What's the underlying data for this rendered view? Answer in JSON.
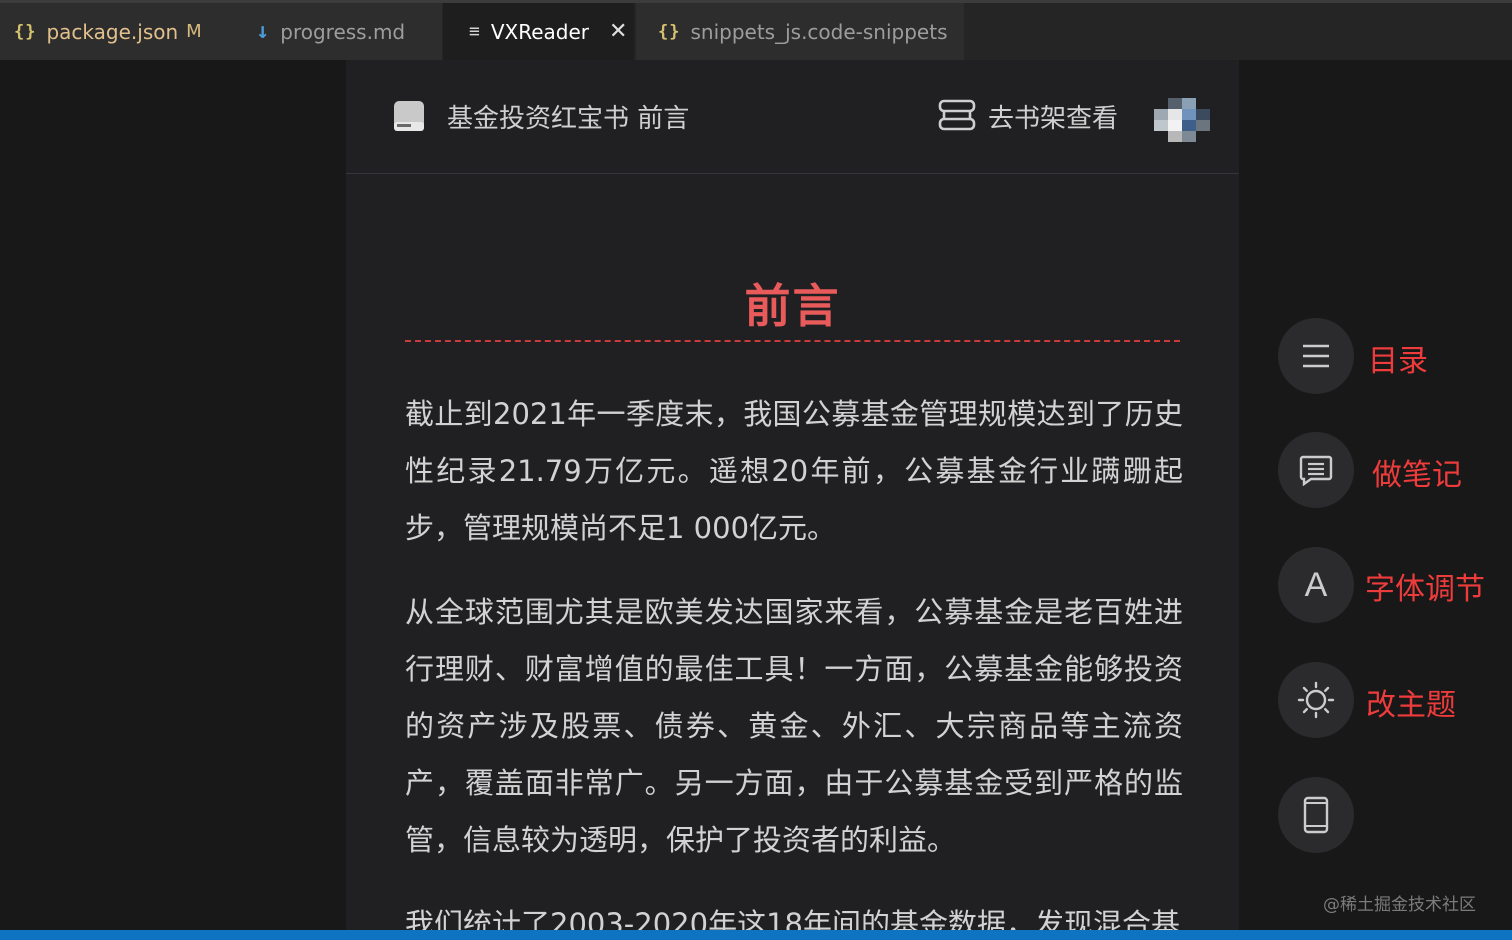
{
  "tabs": [
    {
      "icon": "{}",
      "label": "package.json",
      "modified": "M"
    },
    {
      "icon": "↓",
      "label": "progress.md"
    },
    {
      "icon": "≡",
      "label": "VXReader",
      "close": "✕"
    },
    {
      "icon": "{}",
      "label": "snippets_js.code-snippets"
    }
  ],
  "reader": {
    "book_title": "基金投资红宝书 前言",
    "shelf_label": "去书架查看",
    "chapter_title": "前言",
    "paragraphs": [
      "截止到2021年一季度末，我国公募基金管理规模达到了历史性纪录21.79万亿元。遥想20年前，公募基金行业蹒跚起步，管理规模尚不足1 000亿元。",
      "从全球范围尤其是欧美发达国家来看，公募基金是老百姓进行理财、财富增值的最佳工具！一方面，公募基金能够投资的资产涉及股票、债券、黄金、外汇、大宗商品等主流资产，覆盖面非常广。另一方面，由于公募基金受到严格的监管，信息较为透明，保护了投资者的利益。",
      "我们统计了2003-2020年这18年间的基金数据，发现混合基"
    ]
  },
  "side_menu": {
    "toc_label": "目录",
    "note_label": "做笔记",
    "font_label": "字体调节",
    "font_glyph": "A",
    "theme_label": "改主题"
  },
  "watermark": "@稀土掘金技术社区",
  "colors": {
    "accent_red": "#ee3b3b",
    "status_blue": "#0e73c0"
  }
}
